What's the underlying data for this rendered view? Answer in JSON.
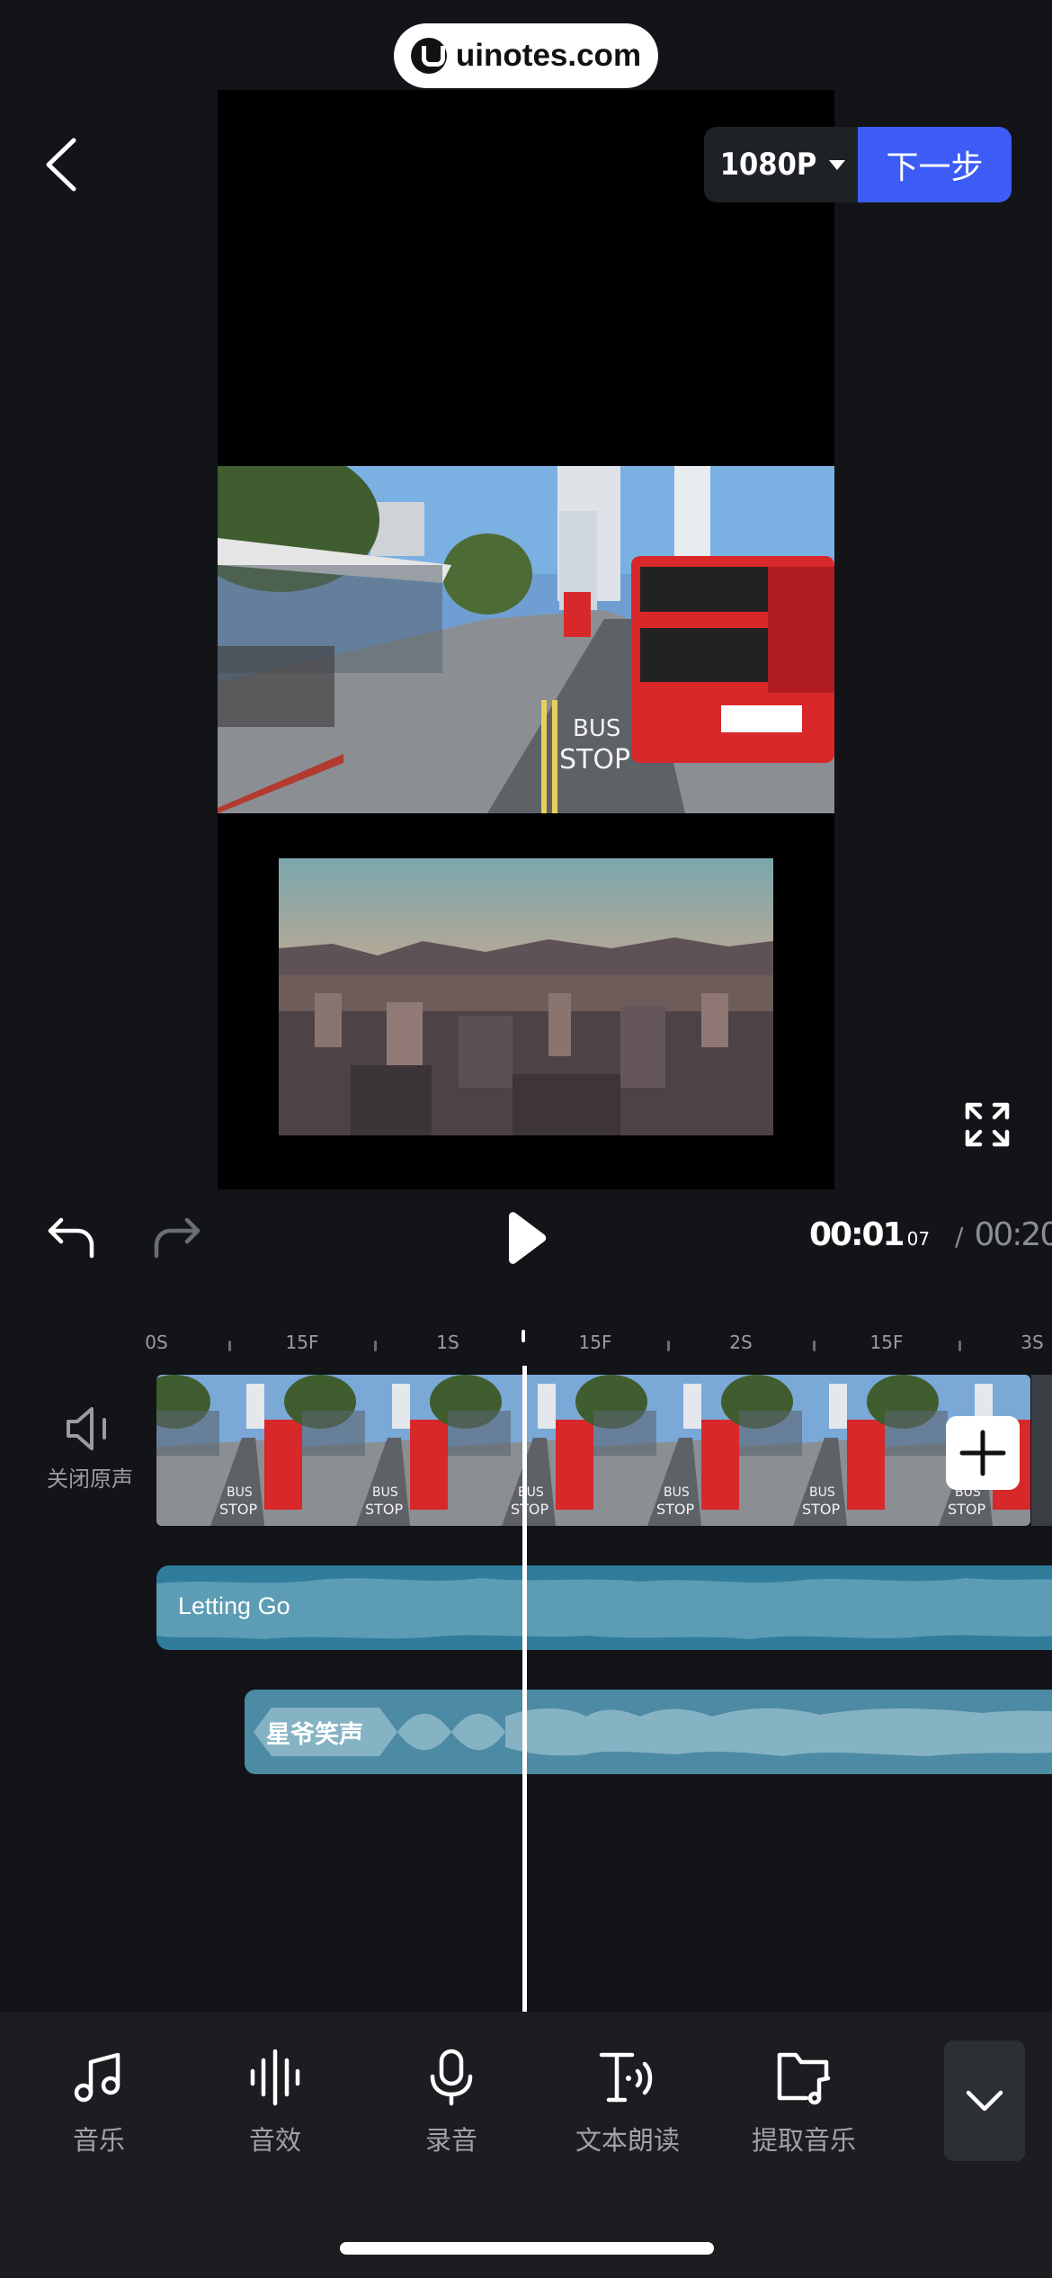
{
  "watermark": {
    "text": "uinotes.com"
  },
  "header": {
    "resolution": "1080P",
    "next_label": "下一步"
  },
  "playback": {
    "current_time": "00:01",
    "current_frame": "07",
    "separator": "/",
    "total_time": "00:20"
  },
  "ruler": {
    "labels": [
      "0S",
      "15F",
      "1S",
      "15F",
      "2S",
      "15F",
      "3S"
    ]
  },
  "tracks": {
    "mute_label": "关闭原声",
    "music_label": "Letting Go",
    "sfx_label": "星爷笑声"
  },
  "toolbar": {
    "items": [
      {
        "label": "音乐",
        "icon": "music-note-icon"
      },
      {
        "label": "音效",
        "icon": "waveform-icon"
      },
      {
        "label": "录音",
        "icon": "microphone-icon"
      },
      {
        "label": "文本朗读",
        "icon": "text-to-speech-icon"
      },
      {
        "label": "提取音乐",
        "icon": "extract-music-folder-icon"
      }
    ]
  },
  "colors": {
    "accent": "#3c5cf5",
    "music_track": "#2f7d9a",
    "sfx_track": "#4d8aa3",
    "background": "#121418"
  }
}
